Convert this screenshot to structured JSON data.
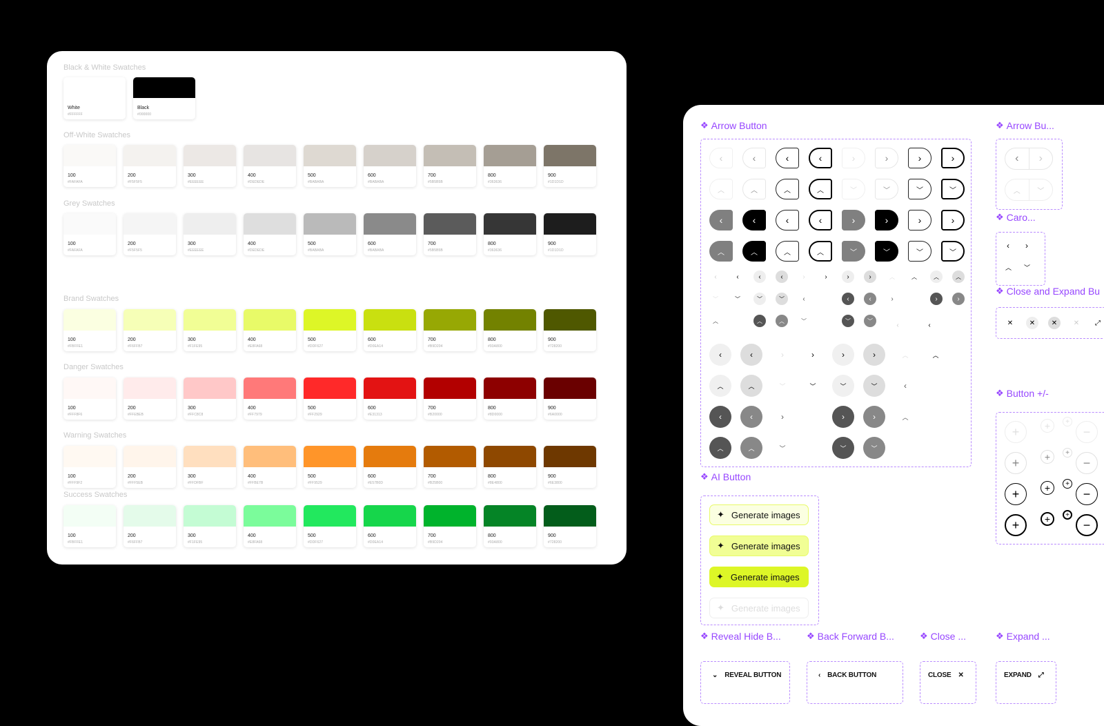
{
  "swatches": {
    "black_white": {
      "title": "Black & White Swatches",
      "items": [
        {
          "name": "White",
          "hex": "#FFFFFF",
          "color": "#FFFFFF"
        },
        {
          "name": "Black",
          "hex": "#000000",
          "color": "#000000"
        }
      ]
    },
    "off_white": {
      "title": "Off-White Swatches",
      "items": [
        {
          "name": "100",
          "hex": "#FAFAFA",
          "color": "#FAF9F7"
        },
        {
          "name": "200",
          "hex": "#F5F5F5",
          "color": "#F4F2EF"
        },
        {
          "name": "300",
          "hex": "#EEEEEE",
          "color": "#ECE8E5"
        },
        {
          "name": "400",
          "hex": "#DEDEDE",
          "color": "#E7E4E2"
        },
        {
          "name": "500",
          "hex": "#BABABA",
          "color": "#DED9D2"
        },
        {
          "name": "600",
          "hex": "#BABABA",
          "color": "#D6D1CB"
        },
        {
          "name": "700",
          "hex": "#5B5B5B",
          "color": "#C4BEB5"
        },
        {
          "name": "800",
          "hex": "#363636",
          "color": "#A59E94"
        },
        {
          "name": "900",
          "hex": "#1D1D1D",
          "color": "#7D7568"
        }
      ]
    },
    "grey": {
      "title": "Grey Swatches",
      "items": [
        {
          "name": "100",
          "hex": "#FAFAFA",
          "color": "#FAFAFA"
        },
        {
          "name": "200",
          "hex": "#F5F5F5",
          "color": "#F5F5F5"
        },
        {
          "name": "300",
          "hex": "#EEEEEE",
          "color": "#EEEEEE"
        },
        {
          "name": "400",
          "hex": "#DEDEDE",
          "color": "#DEDEDE"
        },
        {
          "name": "500",
          "hex": "#BABABA",
          "color": "#BABABA"
        },
        {
          "name": "600",
          "hex": "#BABABA",
          "color": "#8A8A8A"
        },
        {
          "name": "700",
          "hex": "#5B5B5B",
          "color": "#5B5B5B"
        },
        {
          "name": "800",
          "hex": "#363636",
          "color": "#363636"
        },
        {
          "name": "900",
          "hex": "#1D1D1D",
          "color": "#1D1D1D"
        }
      ]
    },
    "brand": {
      "title": "Brand Swatches",
      "items": [
        {
          "name": "100",
          "hex": "#FBFFE1",
          "color": "#FBFFE1"
        },
        {
          "name": "200",
          "hex": "#F6FFB7",
          "color": "#F6FFB7"
        },
        {
          "name": "300",
          "hex": "#F1FE95",
          "color": "#F1FE95"
        },
        {
          "name": "400",
          "hex": "#E8FA68",
          "color": "#E8FA68"
        },
        {
          "name": "500",
          "hex": "#DDF627",
          "color": "#DDF627"
        },
        {
          "name": "600",
          "hex": "#D0EA14",
          "color": "#C9E010"
        },
        {
          "name": "700",
          "hex": "#B9D204",
          "color": "#97A804"
        },
        {
          "name": "800",
          "hex": "#93A800",
          "color": "#738200"
        },
        {
          "name": "900",
          "hex": "#728200",
          "color": "#4F5800"
        }
      ]
    },
    "danger": {
      "title": "Danger Swatches",
      "items": [
        {
          "name": "100",
          "hex": "#FFF8F6",
          "color": "#FFF8F6"
        },
        {
          "name": "200",
          "hex": "#FFEBEB",
          "color": "#FFEBEB"
        },
        {
          "name": "300",
          "hex": "#FFC8C8",
          "color": "#FFC8C8"
        },
        {
          "name": "400",
          "hex": "#FF7979",
          "color": "#FF7979"
        },
        {
          "name": "500",
          "hex": "#FF2929",
          "color": "#FF2929"
        },
        {
          "name": "600",
          "hex": "#E31313",
          "color": "#E31313"
        },
        {
          "name": "700",
          "hex": "#B20000",
          "color": "#B20000"
        },
        {
          "name": "800",
          "hex": "#8D0000",
          "color": "#8D0000"
        },
        {
          "name": "900",
          "hex": "#6A0000",
          "color": "#6A0000"
        }
      ]
    },
    "warning": {
      "title": "Warning Swatches",
      "items": [
        {
          "name": "100",
          "hex": "#FFF9F2",
          "color": "#FFF9F2"
        },
        {
          "name": "200",
          "hex": "#FFF5EB",
          "color": "#FFF5EB"
        },
        {
          "name": "300",
          "hex": "#FFDFBF",
          "color": "#FFDFBF"
        },
        {
          "name": "400",
          "hex": "#FFBE7B",
          "color": "#FFBE7B"
        },
        {
          "name": "500",
          "hex": "#FF9529",
          "color": "#FF9529"
        },
        {
          "name": "600",
          "hex": "#E57B0D",
          "color": "#E57B0D"
        },
        {
          "name": "700",
          "hex": "#B25B00",
          "color": "#B25B00"
        },
        {
          "name": "800",
          "hex": "#8E4800",
          "color": "#8E4800"
        },
        {
          "name": "900",
          "hex": "#6E3800",
          "color": "#6E3800"
        }
      ]
    },
    "success": {
      "title": "Success Swatches",
      "items": [
        {
          "name": "100",
          "hex": "#FBFFE1",
          "color": "#F3FEF5"
        },
        {
          "name": "200",
          "hex": "#F6FFB7",
          "color": "#E4FBEA"
        },
        {
          "name": "300",
          "hex": "#F1FE95",
          "color": "#C4FCD4"
        },
        {
          "name": "400",
          "hex": "#E8FA68",
          "color": "#7BFC9B"
        },
        {
          "name": "500",
          "hex": "#DDF627",
          "color": "#22E85E"
        },
        {
          "name": "600",
          "hex": "#D0EA14",
          "color": "#16D64B"
        },
        {
          "name": "700",
          "hex": "#B9D204",
          "color": "#00B32C"
        },
        {
          "name": "800",
          "hex": "#93A800",
          "color": "#058426"
        },
        {
          "name": "900",
          "hex": "#728200",
          "color": "#035D1B"
        }
      ]
    }
  },
  "components": {
    "arrow_button": {
      "title": "Arrow Button"
    },
    "arrow_button_group": {
      "title": "Arrow Bu..."
    },
    "carousel": {
      "title": "Caro..."
    },
    "close_expand": {
      "title": "Close and Expand Bu"
    },
    "button_plus_minus": {
      "title": "Button +/-"
    },
    "ai_button": {
      "title": "AI Button",
      "label": "Generate images"
    },
    "reveal_hide": {
      "title": "Reveal Hide B...",
      "label": "REVEAL BUTTON"
    },
    "back_forward": {
      "title": "Back Forward B...",
      "label": "BACK BUTTON"
    },
    "close": {
      "title": "Close ...",
      "label": "CLOSE"
    },
    "expand": {
      "title": "Expand ...",
      "label": "EXPAND"
    }
  },
  "colors": {
    "accent": "#9747FF",
    "brand": "#DDF627"
  }
}
